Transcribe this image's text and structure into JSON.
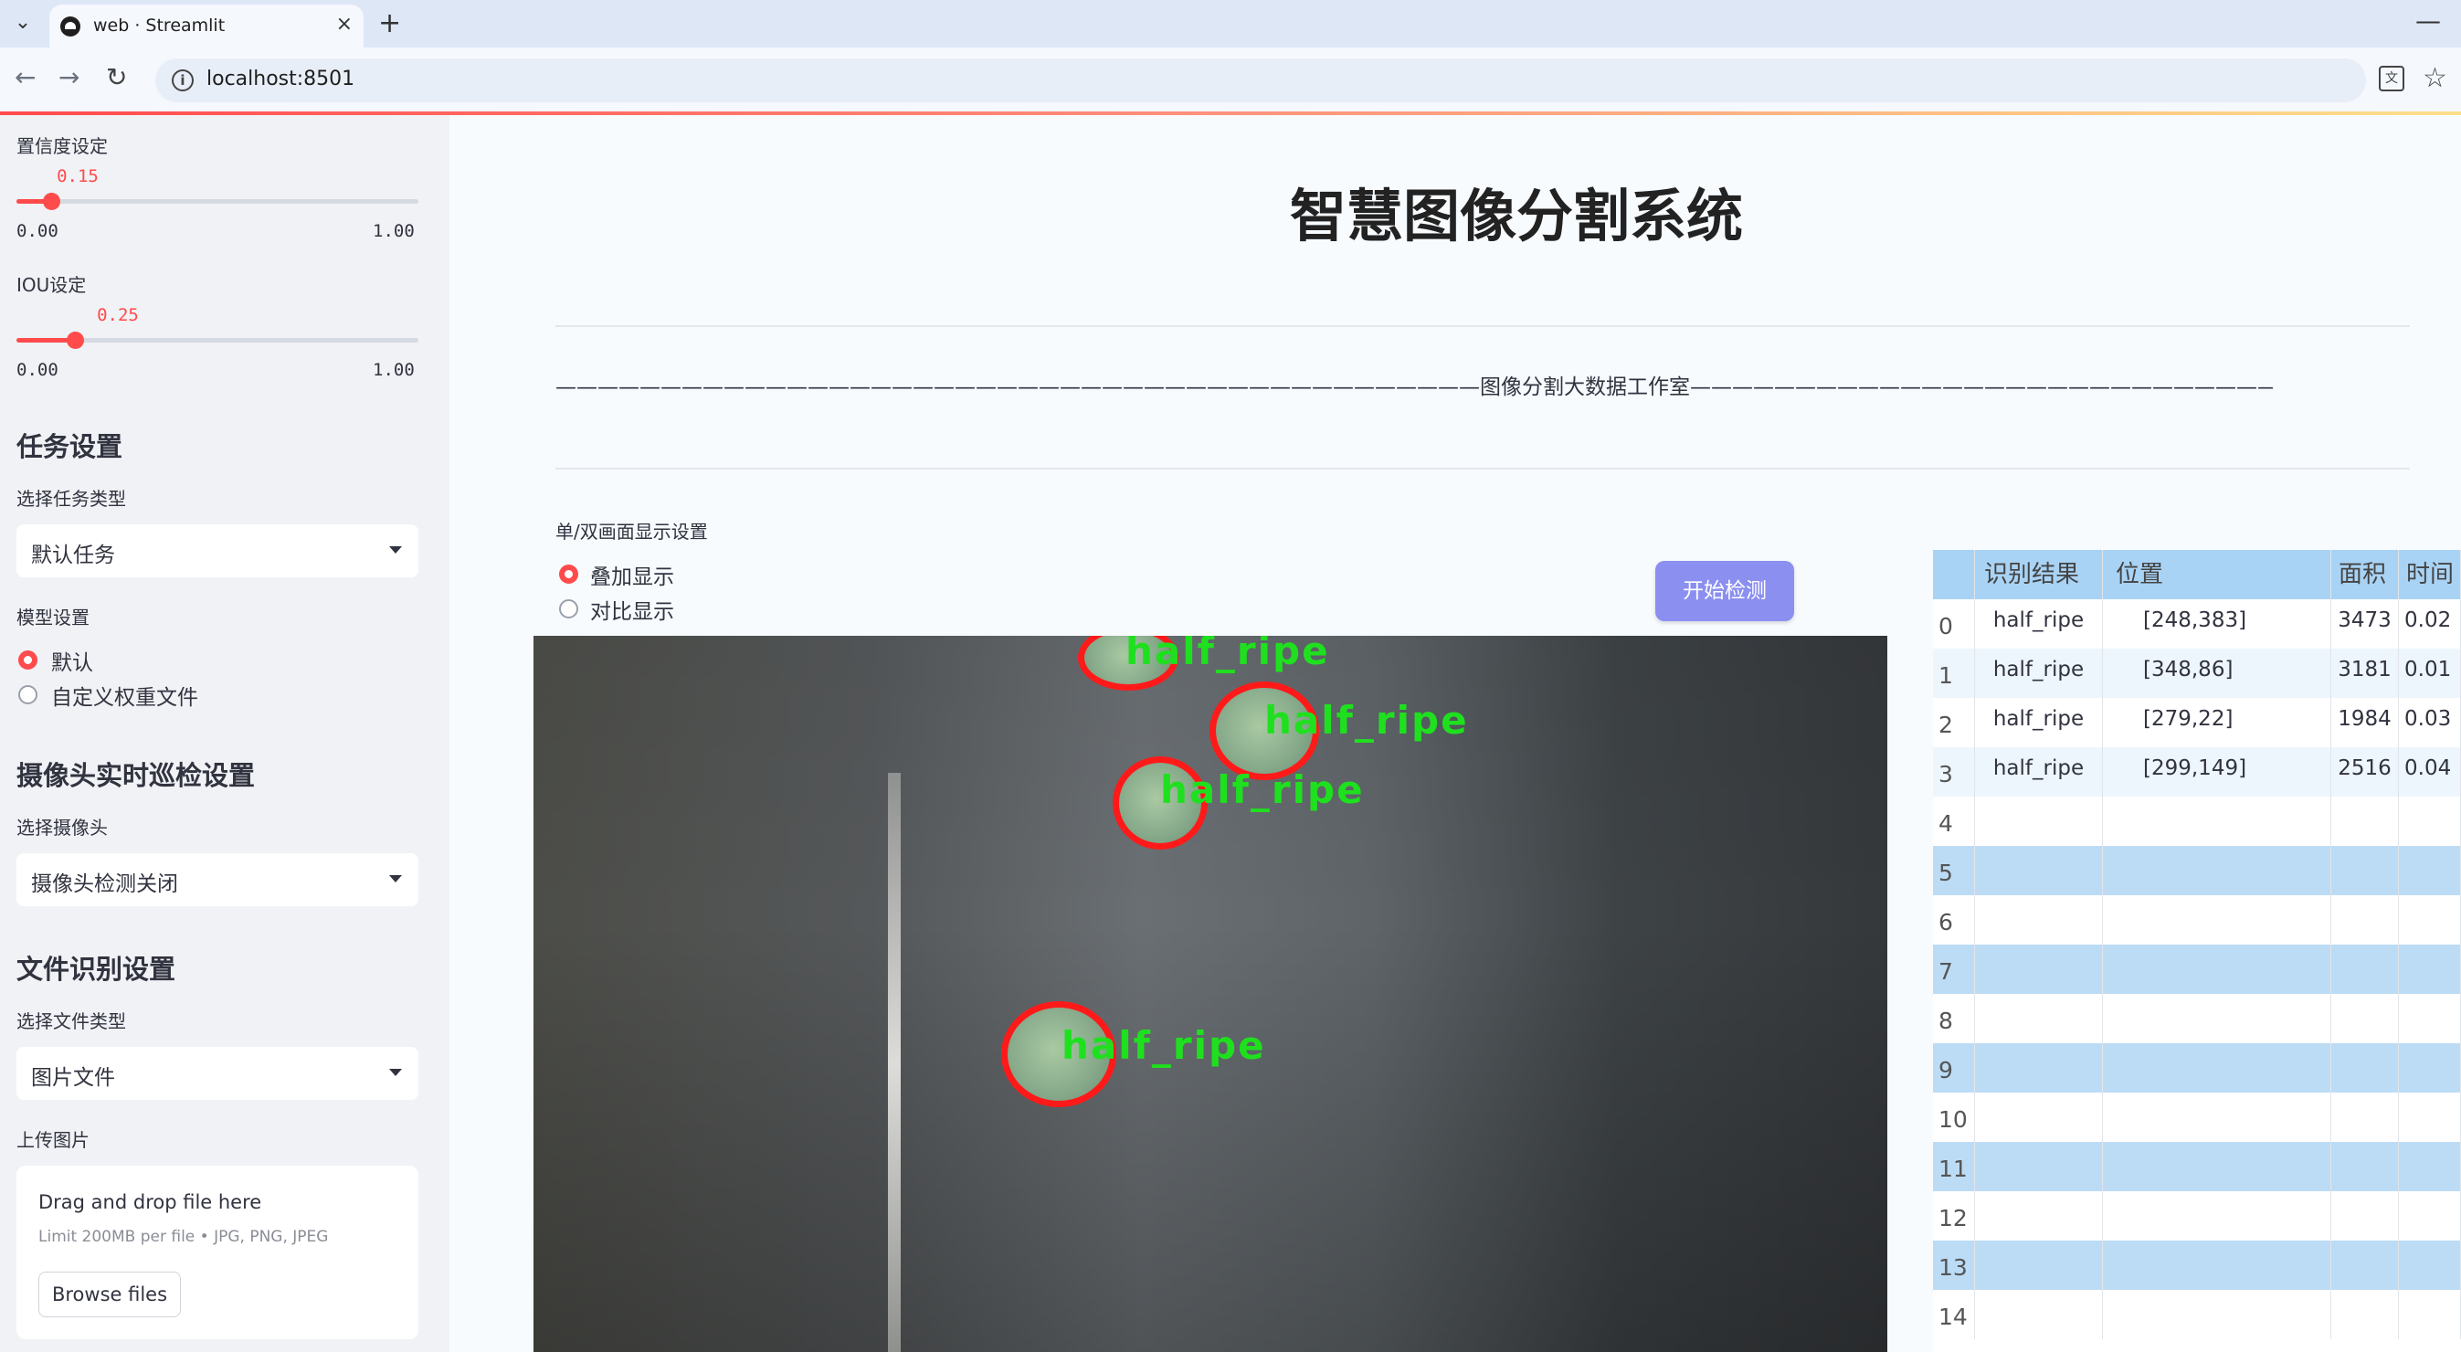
{
  "browser": {
    "tab_title": "web · Streamlit",
    "tab_close": "×",
    "new_tab": "+",
    "minimize": "—",
    "url": "localhost:8501"
  },
  "sidebar": {
    "confidence": {
      "label": "置信度设定",
      "value": "0.15",
      "fraction": 0.15,
      "min": "0.00",
      "max": "1.00"
    },
    "iou": {
      "label": "IOU设定",
      "value": "0.25",
      "fraction": 0.25,
      "min": "0.00",
      "max": "1.00"
    },
    "task_section": "任务设置",
    "task_type_label": "选择任务类型",
    "task_type_value": "默认任务",
    "model_label": "模型设置",
    "model_options": [
      "默认",
      "自定义权重文件"
    ],
    "model_selected": 0,
    "camera_section": "摄像头实时巡检设置",
    "camera_label": "选择摄像头",
    "camera_value": "摄像头检测关闭",
    "file_section": "文件识别设置",
    "file_type_label": "选择文件类型",
    "file_type_value": "图片文件",
    "upload_label": "上传图片",
    "upload_title": "Drag and drop file here",
    "upload_limit": "Limit 200MB per file • JPG, PNG, JPEG",
    "browse_button": "Browse files"
  },
  "main": {
    "title": "智慧图像分割系统",
    "banner": "————————————————————————————————————————————图像分割大数据工作室————————————————————————————————————————————",
    "display_label": "单/双画面显示设置",
    "display_options": [
      "叠加显示",
      "对比显示"
    ],
    "display_selected": 0,
    "start_button": "开始检测",
    "detections": [
      "half_ripe",
      "half_ripe",
      "half_ripe",
      "half_ripe"
    ]
  },
  "table": {
    "headers": [
      "",
      "识别结果",
      "位置",
      "面积",
      "时间"
    ],
    "rows": [
      [
        "0",
        "half_ripe",
        "[248,383]",
        "3473",
        "0.02"
      ],
      [
        "1",
        "half_ripe",
        "[348,86]",
        "3181",
        "0.01"
      ],
      [
        "2",
        "half_ripe",
        "[279,22]",
        "1984",
        "0.03"
      ],
      [
        "3",
        "half_ripe",
        "[299,149]",
        "2516",
        "0.04"
      ],
      [
        "4",
        "",
        "",
        "",
        ""
      ],
      [
        "5",
        "",
        "",
        "",
        ""
      ],
      [
        "6",
        "",
        "",
        "",
        ""
      ],
      [
        "7",
        "",
        "",
        "",
        ""
      ],
      [
        "8",
        "",
        "",
        "",
        ""
      ],
      [
        "9",
        "",
        "",
        "",
        ""
      ],
      [
        "10",
        "",
        "",
        "",
        ""
      ],
      [
        "11",
        "",
        "",
        "",
        ""
      ],
      [
        "12",
        "",
        "",
        "",
        ""
      ],
      [
        "13",
        "",
        "",
        "",
        ""
      ],
      [
        "14",
        "",
        "",
        "",
        ""
      ]
    ]
  }
}
